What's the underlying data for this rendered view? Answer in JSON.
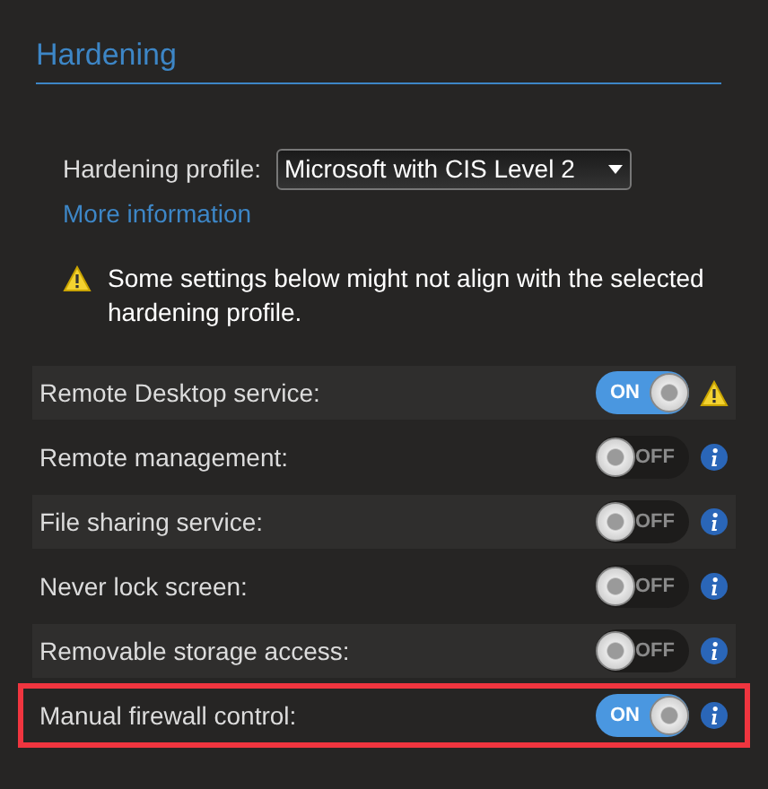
{
  "section": {
    "title": "Hardening"
  },
  "profile": {
    "label": "Hardening profile:",
    "value": "Microsoft with CIS Level 2",
    "link": "More information"
  },
  "warning": {
    "text": "Some settings below might not align with the selected hardening profile."
  },
  "settings": [
    {
      "label": "Remote Desktop service:",
      "on": true,
      "toggle_text": "ON",
      "kind": "warning",
      "highlighted": false
    },
    {
      "label": "Remote management:",
      "on": false,
      "toggle_text": "OFF",
      "kind": "info",
      "highlighted": false
    },
    {
      "label": "File sharing service:",
      "on": false,
      "toggle_text": "OFF",
      "kind": "info",
      "highlighted": false
    },
    {
      "label": "Never lock screen:",
      "on": false,
      "toggle_text": "OFF",
      "kind": "info",
      "highlighted": false
    },
    {
      "label": "Removable storage access:",
      "on": false,
      "toggle_text": "OFF",
      "kind": "info",
      "highlighted": false
    },
    {
      "label": "Manual firewall control:",
      "on": true,
      "toggle_text": "ON",
      "kind": "info",
      "highlighted": true
    }
  ]
}
